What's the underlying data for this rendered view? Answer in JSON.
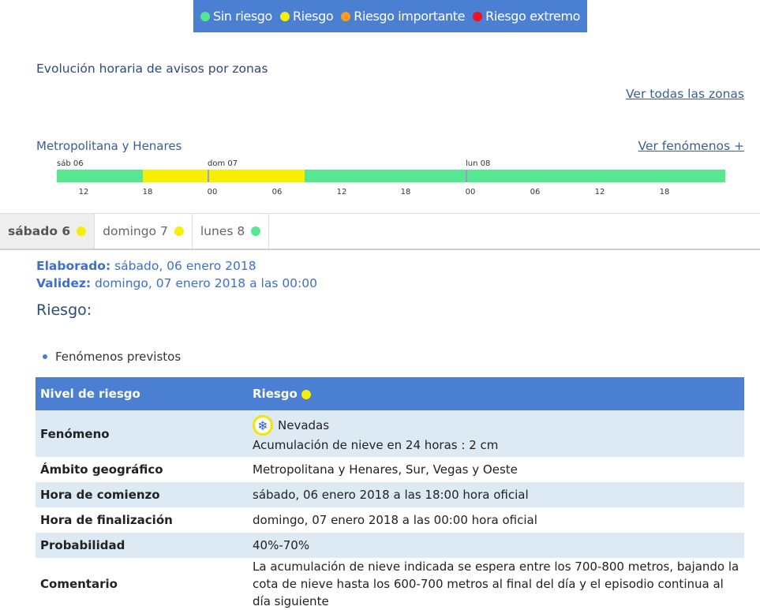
{
  "legend": [
    {
      "label": "Sin riesgo",
      "color": "#56e890"
    },
    {
      "label": "Riesgo",
      "color": "#f7ef00"
    },
    {
      "label": "Riesgo importante",
      "color": "#ff9a1a"
    },
    {
      "label": "Riesgo extremo",
      "color": "#f2111f"
    }
  ],
  "section_title": "Evolución horaria de avisos por zonas",
  "see_all_zones": "Ver todas las zonas",
  "zone": {
    "name": "Metropolitana y Henares",
    "see_phenomena": "Ver fenómenos +"
  },
  "timeline": {
    "days": [
      "sáb 06",
      "dom 07",
      "lun 08"
    ],
    "ticks": [
      "12",
      "18",
      "00",
      "06",
      "12",
      "18",
      "00",
      "06",
      "12",
      "18"
    ],
    "segments": [
      {
        "level": "Sin riesgo",
        "color": "#56e890"
      },
      {
        "level": "Riesgo",
        "color": "#f7ef00"
      },
      {
        "level": "Sin riesgo",
        "color": "#56e890"
      }
    ]
  },
  "tabs": [
    {
      "label": "sábado 6",
      "color": "#f7ef00",
      "active": true
    },
    {
      "label": "domingo 7",
      "color": "#f7ef00",
      "active": false
    },
    {
      "label": "lunes 8",
      "color": "#56e890",
      "active": false
    }
  ],
  "elaborado": {
    "label": "Elaborado:",
    "value": "sábado, 06 enero 2018"
  },
  "validez": {
    "label": "Validez:",
    "value": "domingo, 07 enero 2018 a las 00:00"
  },
  "riesgo_heading": "Riesgo:",
  "bullet": "Fenómenos previstos",
  "table": {
    "head": {
      "col1": "Nivel de riesgo",
      "col2": "Riesgo",
      "color": "#f7ef00"
    },
    "fenomeno": {
      "label": "Fenómeno",
      "icon": "snowflake-icon",
      "name": "Nevadas",
      "detail": "Acumulación de nieve en 24 horas : 2 cm"
    },
    "ambito": {
      "label": "Ámbito geográfico",
      "value": "Metropolitana y Henares, Sur, Vegas y Oeste"
    },
    "comienzo": {
      "label": "Hora de comienzo",
      "value": "sábado, 06 enero 2018 a las 18:00 hora oficial"
    },
    "fin": {
      "label": "Hora de finalización",
      "value": "domingo, 07 enero 2018 a las 00:00 hora oficial"
    },
    "probabilidad": {
      "label": "Probabilidad",
      "value": "40%-70%"
    },
    "comentario": {
      "label": "Comentario",
      "value": "La acumulación de nieve indicada se espera entre los 700-800 metros, bajando la cota de nieve hasta los 600-700 metros al final del día y el episodio continua al día siguiente"
    }
  }
}
